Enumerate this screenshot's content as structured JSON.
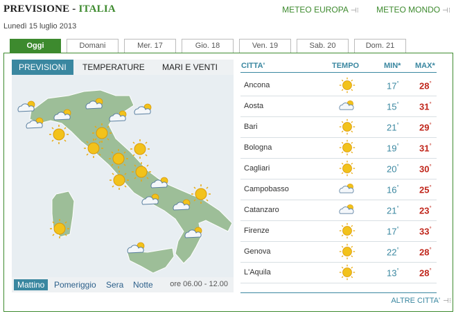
{
  "header": {
    "title_a": "PREVISIONE",
    "title_sep": " - ",
    "title_b": "ITALIA",
    "links": [
      {
        "label": "METEO EUROPA"
      },
      {
        "label": "METEO MONDO"
      }
    ],
    "date": "Lunedì 15 luglio 2013"
  },
  "day_tabs": [
    {
      "label": "Oggi",
      "active": true
    },
    {
      "label": "Domani"
    },
    {
      "label": "Mer. 17"
    },
    {
      "label": "Gio. 18"
    },
    {
      "label": "Ven. 19"
    },
    {
      "label": "Sab. 20"
    },
    {
      "label": "Dom. 21"
    }
  ],
  "map": {
    "tabs": [
      "PREVISIONI",
      "TEMPERATURE",
      "MARI E VENTI"
    ],
    "active_tab": "PREVISIONI",
    "times": [
      "Mattino",
      "Pomeriggio",
      "Sera",
      "Notte"
    ],
    "active_time": "Mattino",
    "time_range": "ore 06.00 - 12.00"
  },
  "table": {
    "headers": {
      "city": "CITTA'",
      "weather": "TEMPO",
      "min": "MIN*",
      "max": "MAX*"
    },
    "rows": [
      {
        "city": "Ancona",
        "weather": "sun-icon",
        "min": "17",
        "max": "28"
      },
      {
        "city": "Aosta",
        "weather": "cloud-sun-icon",
        "min": "15",
        "max": "31"
      },
      {
        "city": "Bari",
        "weather": "sun-icon",
        "min": "21",
        "max": "29"
      },
      {
        "city": "Bologna",
        "weather": "sun-icon",
        "min": "19",
        "max": "31"
      },
      {
        "city": "Cagliari",
        "weather": "sun-icon",
        "min": "20",
        "max": "30"
      },
      {
        "city": "Campobasso",
        "weather": "cloud-sun-icon",
        "min": "16",
        "max": "25"
      },
      {
        "city": "Catanzaro",
        "weather": "cloud-sun-icon",
        "min": "21",
        "max": "23"
      },
      {
        "city": "Firenze",
        "weather": "sun-icon",
        "min": "17",
        "max": "33"
      },
      {
        "city": "Genova",
        "weather": "sun-icon",
        "min": "22",
        "max": "28"
      },
      {
        "city": "L'Aquila",
        "weather": "sun-icon",
        "min": "13",
        "max": "28"
      }
    ],
    "degree": "°",
    "more_link": "ALTRE CITTA'"
  },
  "colors": {
    "green": "#3d8a2e",
    "teal": "#3a87a0",
    "red": "#c0261b"
  }
}
